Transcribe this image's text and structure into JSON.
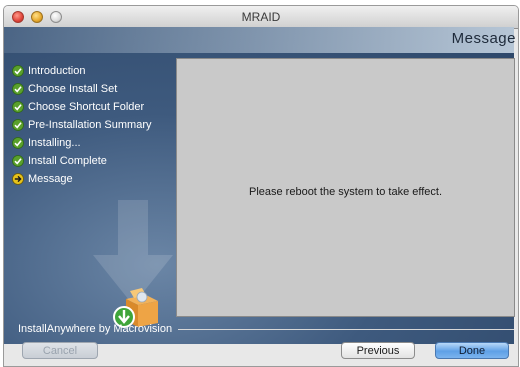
{
  "window": {
    "title": "MRAID"
  },
  "header": {
    "title": "Message"
  },
  "steps": [
    {
      "label": "Introduction",
      "status": "complete"
    },
    {
      "label": "Choose Install Set",
      "status": "complete"
    },
    {
      "label": "Choose Shortcut Folder",
      "status": "complete"
    },
    {
      "label": "Pre-Installation Summary",
      "status": "complete"
    },
    {
      "label": "Installing...",
      "status": "complete"
    },
    {
      "label": "Install Complete",
      "status": "complete"
    },
    {
      "label": "Message",
      "status": "current"
    }
  ],
  "content": {
    "message": "Please reboot the system to take effect."
  },
  "footer": {
    "brand": "InstallAnywhere by Macrovision"
  },
  "buttons": {
    "cancel": "Cancel",
    "previous": "Previous",
    "done": "Done"
  },
  "colors": {
    "background": "#3e5a7e",
    "panel": "#c9c9c9",
    "check": "#5aa02c",
    "current": "#e6c21a"
  }
}
